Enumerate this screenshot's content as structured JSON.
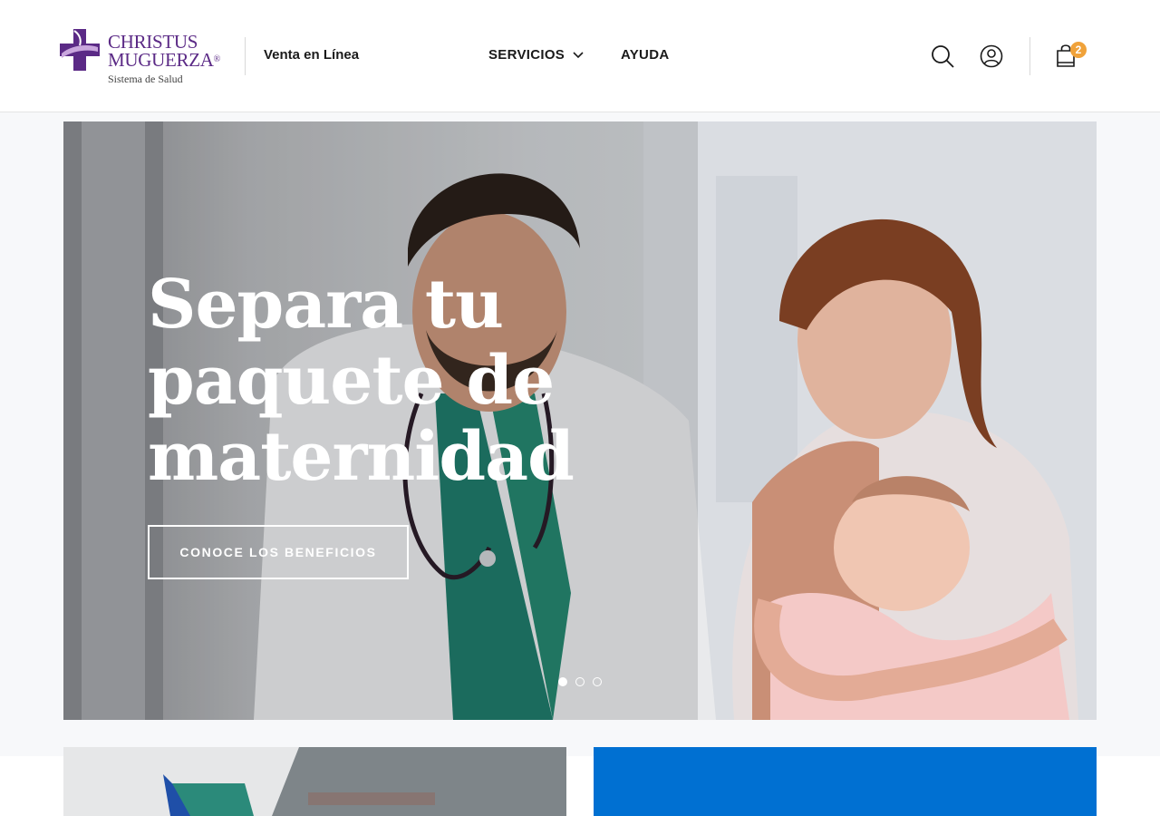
{
  "header": {
    "logo": {
      "name_line1": "CHRISTUS",
      "name_line2": "MUGUERZA",
      "registered": "®",
      "tagline": "Sistema de Salud",
      "brand_color": "#5b2a86"
    },
    "site_label": "Venta en Línea",
    "nav": [
      {
        "label": "SERVICIOS",
        "has_dropdown": true
      },
      {
        "label": "AYUDA",
        "has_dropdown": false
      }
    ],
    "icons": [
      "search-icon",
      "user-icon",
      "shopping-bag-icon"
    ],
    "cart_count": "2",
    "badge_color": "#f0a23a"
  },
  "hero": {
    "title": "Separa tu paquete de maternidad",
    "cta_label": "CONOCE LOS BENEFICIOS",
    "slides": 3,
    "active_slide": 1
  },
  "cards": {
    "right_color": "#0070d2"
  }
}
